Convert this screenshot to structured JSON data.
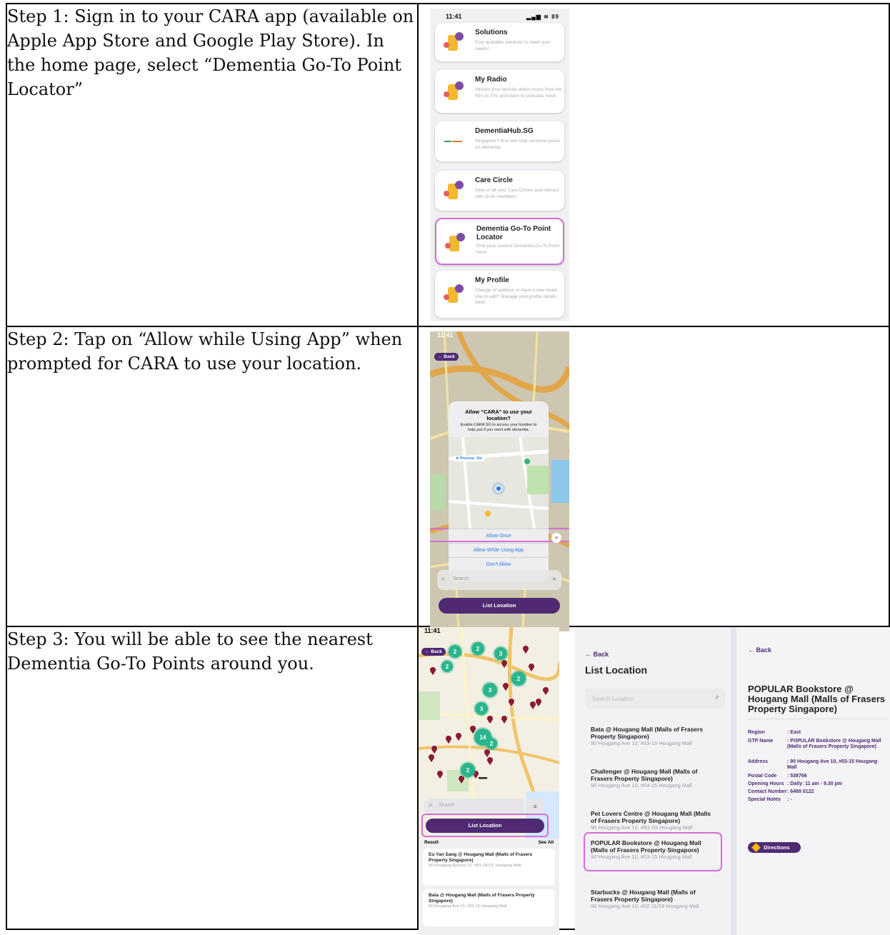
{
  "steps": [
    {
      "text": "Step 1: Sign in to your CARA app (available on Apple App Store and Google Play Store). In the home page, select “Dementia Go-To Point Locator”"
    },
    {
      "text": "Step 2: Tap on “Allow while Using App” when prompted for CARA to use your location."
    },
    {
      "text": "Step 3: You will be able to see the nearest Dementia Go-To Points around you."
    }
  ],
  "phone1": {
    "time": "11:41",
    "status_icons": "▂▄▆ ≋ 89",
    "cards": [
      {
        "title": "Solutions",
        "desc": "Find available solutions to meet your needs!",
        "icon": "solutions-icon"
      },
      {
        "title": "My Radio",
        "desc": "Stream your favorite oldies music from the 50's to 70's and listen to podcasts here!",
        "icon": "radio-icon"
      },
      {
        "title": "DementiaHub.SG",
        "desc": "Singapore's first one-stop resource portal on dementia",
        "icon": "dementiahub-logo"
      },
      {
        "title": "Care Circle",
        "desc": "View of all your Care Circles and interact with circle members.",
        "icon": "care-circle-icon"
      },
      {
        "title": "Dementia Go-To Point Locator",
        "desc": "Find your nearest Dementia Go-To Point here!",
        "icon": "locator-icon"
      },
      {
        "title": "My Profile",
        "desc": "Change of address or have a new loved one to add? Manage your profile details here!",
        "icon": "profile-icon"
      }
    ]
  },
  "phone2": {
    "time": "11:41",
    "back": "← Back",
    "dialog_title": "Allow “CARA” to use your location?",
    "dialog_desc": "Enable CARA SG to access your location to help you if you meet with dementia.",
    "precise": "➤ Precise: On",
    "allow_once": "Allow Once",
    "allow_while": "Allow While Using App",
    "dont_allow": "Don't Allow",
    "search": "Search",
    "list_location": "List Location"
  },
  "phone3": {
    "time": "11:41",
    "back": "← Back",
    "search": "Search",
    "list_location": "List Location",
    "result": "Result",
    "see_all": "See All",
    "results": [
      {
        "name": "Eu Yan Sang @ Hougang Mall (Malls of Frasers Property Singapore)",
        "address": "90 Hougang Avenue 10, #B1-18/19, Hougang Mall"
      },
      {
        "name": "Bata @ Hougang Mall (Malls of Frasers Property Singapore)",
        "address": "90 Hougang Ave 10, #03-16 Hougang Mall"
      }
    ],
    "clusters": [
      "2",
      "2",
      "2",
      "3",
      "3",
      "2",
      "3",
      "14",
      "2",
      "2"
    ]
  },
  "list_panel": {
    "back": "← Back",
    "title": "List Location",
    "search_placeholder": "Search Location",
    "items": [
      {
        "name": "Bata @ Hougang Mall (Malls of Frasers Property Singapore)",
        "address": "90 Hougang Ave 10, #03-16 Hougang Mall"
      },
      {
        "name": "Challenger @ Hougang Mall (Malls of Frasers Property Singapore)",
        "address": "90 Hougang Ave 10, #04-15 Hougang Mall"
      },
      {
        "name": "Pet Lovers Centre @ Hougang Mall (Malls of Frasers Property Singapore)",
        "address": "90 Hougang Ave 10, #B1-03 Hougang Mall"
      },
      {
        "name": "POPULAR Bookstore @ Hougang Mall (Malls of Frasers Property Singapore)",
        "address": "90 Hougang Ave 10, #03-15 Hougang Mall"
      },
      {
        "name": "Starbucks @ Hougang Mall (Malls of Frasers Property Singapore)",
        "address": "90 Hougang Ave 10, #02-11/19 Hougang Mall"
      }
    ]
  },
  "detail_panel": {
    "back": "← Back",
    "title": "POPULAR Bookstore @ Hougang Mall (Malls of Frasers Property Singapore)",
    "rows": [
      {
        "k": "Region",
        "v": ": East"
      },
      {
        "k": "GTP Name",
        "v": ": POPULAR Bookstore @ Hougang Mall (Malls of Frasers Property Singapore)"
      },
      {
        "k": "Address",
        "v": ": 90 Hougang Ave 10, #03-15 Hougang Mall"
      },
      {
        "k": "Postal Code",
        "v": ": 538766"
      },
      {
        "k": "Opening Hours",
        "v": ": Daily: 11 am - 9.30 pm"
      },
      {
        "k": "Contact Number",
        "v": ": 6488 0122"
      },
      {
        "k": "Special Notes",
        "v": ": -"
      }
    ],
    "directions": "Directions"
  },
  "colors": {
    "accent": "#4f2a73",
    "highlight": "#d46fd6",
    "cluster": "#2cb58c",
    "link": "#2b7de0"
  }
}
